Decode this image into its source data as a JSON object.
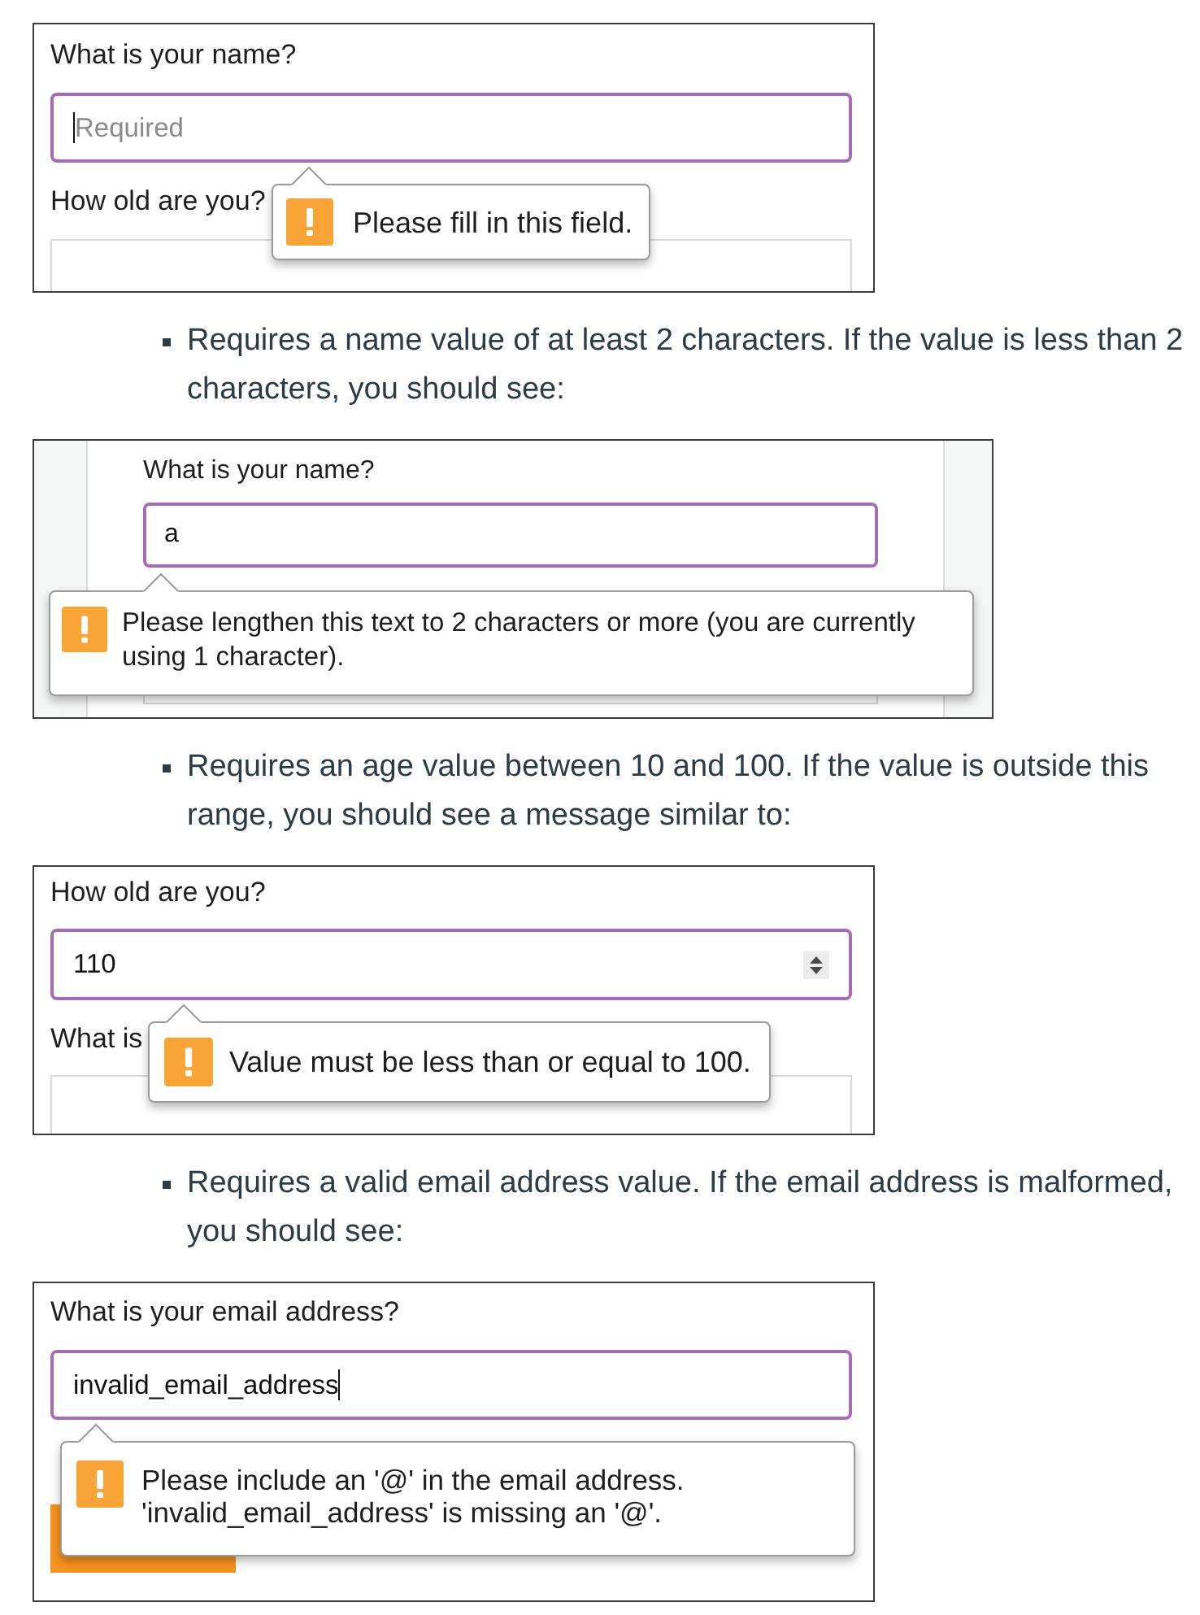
{
  "blocks": [
    {
      "kind": "screenshot",
      "fields": [
        {
          "kind": "text",
          "label": "What is your name?",
          "placeholder": "Required",
          "focused": true,
          "caret": true
        },
        {
          "kind": "text",
          "label": "How old are you?",
          "focused": false,
          "caret": false
        }
      ],
      "tooltip": {
        "message": "Please fill in this field."
      }
    },
    {
      "kind": "bullet",
      "text": "Requires a name value of at least 2 characters. If the value is less than 2 characters, you should see:"
    },
    {
      "kind": "screenshot",
      "fields": [
        {
          "kind": "text",
          "label": "What is your name?",
          "value": "a",
          "focused": true,
          "caret": false
        },
        {
          "kind": "text",
          "focused": false,
          "caret": false
        }
      ],
      "tooltip": {
        "message": "Please lengthen this text to 2 characters or more (you are currently using 1 character)."
      }
    },
    {
      "kind": "bullet",
      "text": "Requires an age value between 10 and 100. If the value is outside this range, you should see a message similar to:"
    },
    {
      "kind": "screenshot",
      "fields": [
        {
          "kind": "number",
          "label": "How old are you?",
          "value": "110",
          "focused": true,
          "caret": false
        },
        {
          "kind": "text",
          "label": "What is",
          "focused": false,
          "caret": false
        }
      ],
      "tooltip": {
        "message": "Value must be less than or equal to 100."
      }
    },
    {
      "kind": "bullet",
      "text": "Requires a valid email address value. If the email address is malformed, you should see:"
    },
    {
      "kind": "screenshot",
      "fields": [
        {
          "kind": "text",
          "label": "What is your email address?",
          "value": "invalid_email_address",
          "focused": true,
          "caret": true
        },
        {
          "kind": "button"
        }
      ],
      "tooltip": {
        "message": "Please include an '@' in the email address.\n'invalid_email_address' is missing an '@'."
      }
    }
  ]
}
